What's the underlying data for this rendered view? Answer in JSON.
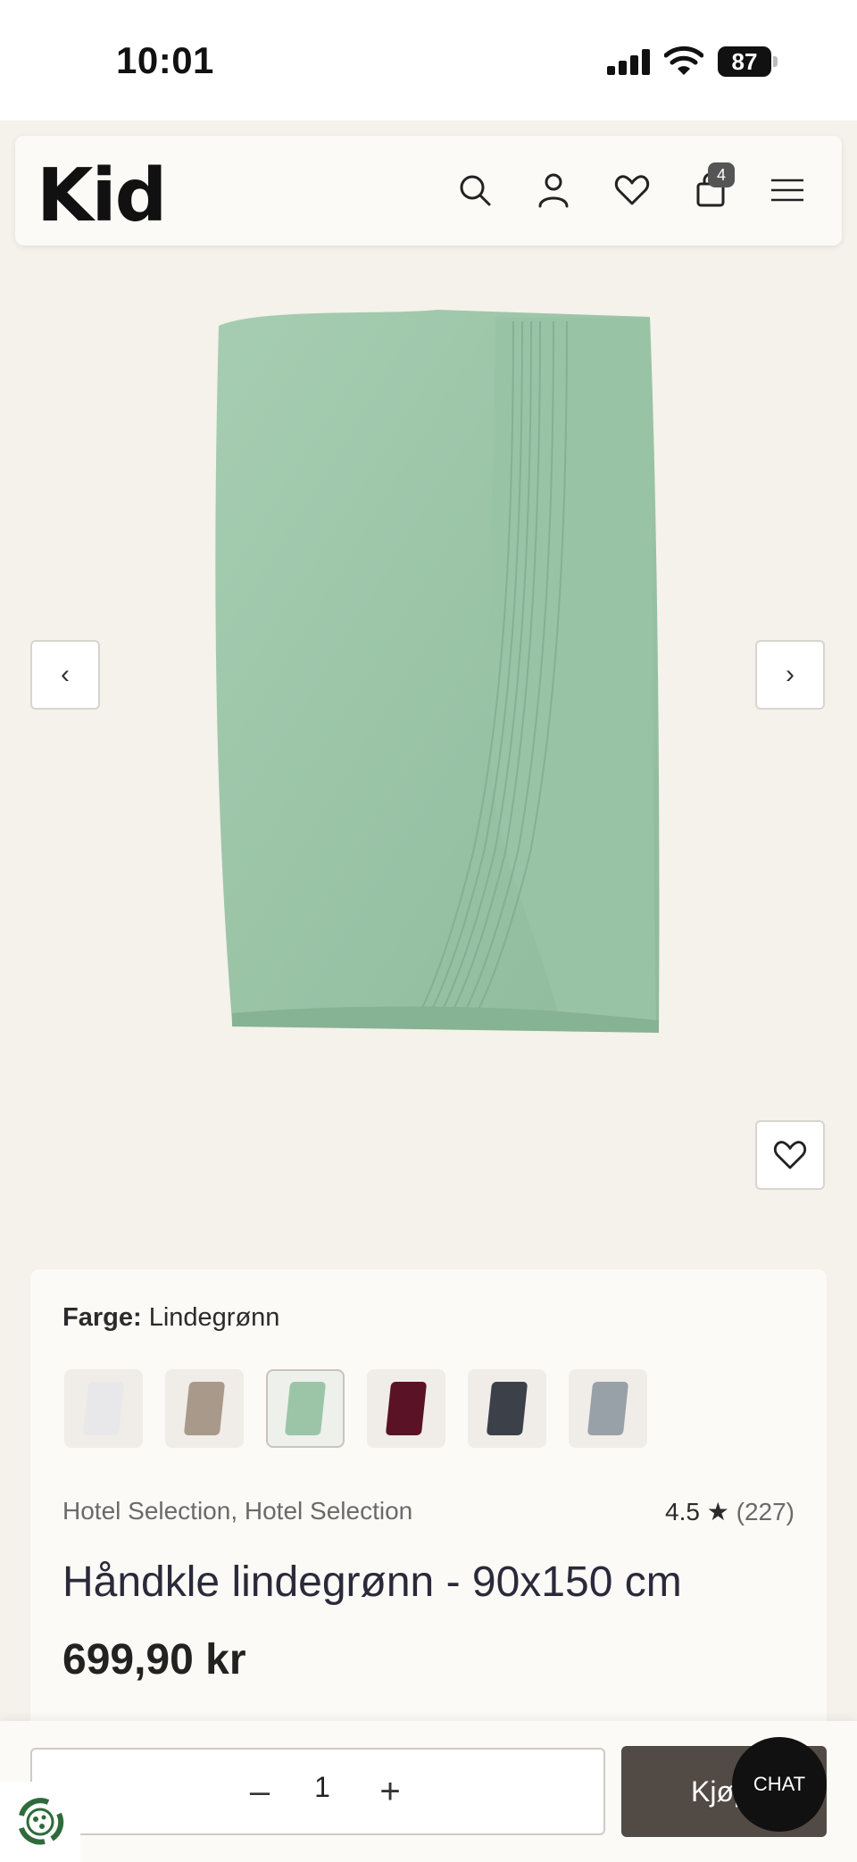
{
  "status": {
    "time": "10:01",
    "battery": "87"
  },
  "header": {
    "logo": "Kid",
    "cart_count": "4"
  },
  "icons": {
    "search": "search-icon",
    "account": "user-icon",
    "wishlist": "heart-icon",
    "cart": "bag-icon",
    "menu": "hamburger-icon"
  },
  "gallery": {
    "prev": "‹",
    "next": "›"
  },
  "product": {
    "color_label": "Farge:",
    "color_value": "Lindegrønn",
    "swatches": [
      {
        "name": "Hvit",
        "color": "#e8e8ea",
        "selected": false
      },
      {
        "name": "Beige",
        "color": "#a8998a",
        "selected": false
      },
      {
        "name": "Lindegrønn",
        "color": "#9cc5a8",
        "selected": true
      },
      {
        "name": "Bordeaux",
        "color": "#5a1226",
        "selected": false
      },
      {
        "name": "Mørk grå",
        "color": "#3c4048",
        "selected": false
      },
      {
        "name": "Grå blå",
        "color": "#98a0a8",
        "selected": false
      }
    ],
    "brand": "Hotel Selection, Hotel Selection",
    "rating": "4.5",
    "rating_star": "★",
    "review_count": "(227)",
    "title": "Håndkle lindegrønn - 90x150 cm",
    "price": "699,90 kr"
  },
  "cart_bar": {
    "minus": "–",
    "quantity": "1",
    "plus": "+",
    "buy_label": "Kjøp",
    "chat_label": "CHAT"
  },
  "colors": {
    "towel": "#9cc5a8",
    "buy_button": "#524a45",
    "background": "#f5f1eb"
  }
}
